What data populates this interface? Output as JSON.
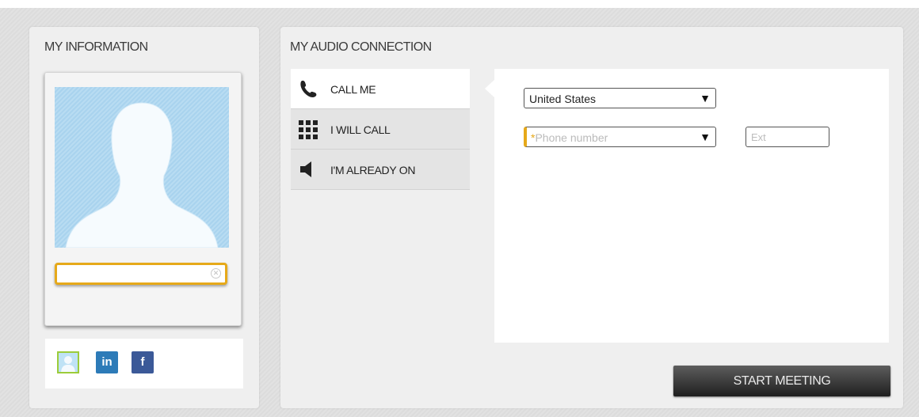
{
  "my_information": {
    "title": "MY INFORMATION",
    "name_input": {
      "value": "",
      "placeholder": ""
    },
    "social_links": [
      {
        "name": "profile",
        "label": ""
      },
      {
        "name": "linkedin",
        "label": "in"
      },
      {
        "name": "facebook",
        "label": "f"
      }
    ]
  },
  "audio_connection": {
    "title": "MY AUDIO CONNECTION",
    "tabs": [
      {
        "label": "CALL ME",
        "icon": "phone-icon",
        "active": true
      },
      {
        "label": "I WILL CALL",
        "icon": "keypad-icon",
        "active": false
      },
      {
        "label": "I'M ALREADY ON",
        "icon": "speaker-icon",
        "active": false
      }
    ],
    "country_select": {
      "value": "United States"
    },
    "phone_select": {
      "required_mark": "*",
      "placeholder": "Phone number"
    },
    "ext_field": {
      "placeholder": "Ext"
    },
    "start_button": "START MEETING"
  },
  "colors": {
    "accent_yellow": "#e6a91a",
    "button_dark": "#1f1f1f",
    "avatar_blue": "#a9d3ee",
    "linkedin_blue": "#2d7bb8",
    "facebook_blue": "#3b5998"
  }
}
